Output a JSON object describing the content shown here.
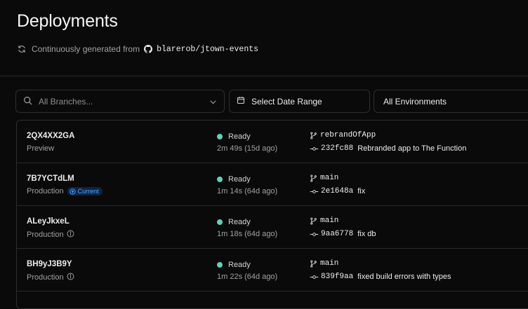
{
  "page": {
    "title": "Deployments",
    "subtitle_prefix": "Continuously generated from",
    "repo": "blarerob/jtown-events"
  },
  "filters": {
    "branch_placeholder": "All Branches...",
    "date_label": "Select Date Range",
    "env_label": "All Environments"
  },
  "status_color": "#5fd3b6",
  "deployments": [
    {
      "id": "2QX4XX2GA",
      "environment": "Preview",
      "badge": "",
      "status": "Ready",
      "duration": "2m 49s (15d ago)",
      "branch": "rebrandOfApp",
      "commit_hash": "232fc88",
      "commit_message": "Rebranded app to The Function"
    },
    {
      "id": "7B7YCTdLM",
      "environment": "Production",
      "badge": "Current",
      "status": "Ready",
      "duration": "1m 14s (64d ago)",
      "branch": "main",
      "commit_hash": "2e1648a",
      "commit_message": "fix"
    },
    {
      "id": "ALeyJkxeL",
      "environment": "Production",
      "badge": "",
      "status": "Ready",
      "duration": "1m 18s (64d ago)",
      "branch": "main",
      "commit_hash": "9aa6778",
      "commit_message": "fix db"
    },
    {
      "id": "BH9yJ3B9Y",
      "environment": "Production",
      "badge": "",
      "status": "Ready",
      "duration": "1m 22s (64d ago)",
      "branch": "main",
      "commit_hash": "839f9aa",
      "commit_message": "fixed build errors with types"
    }
  ]
}
